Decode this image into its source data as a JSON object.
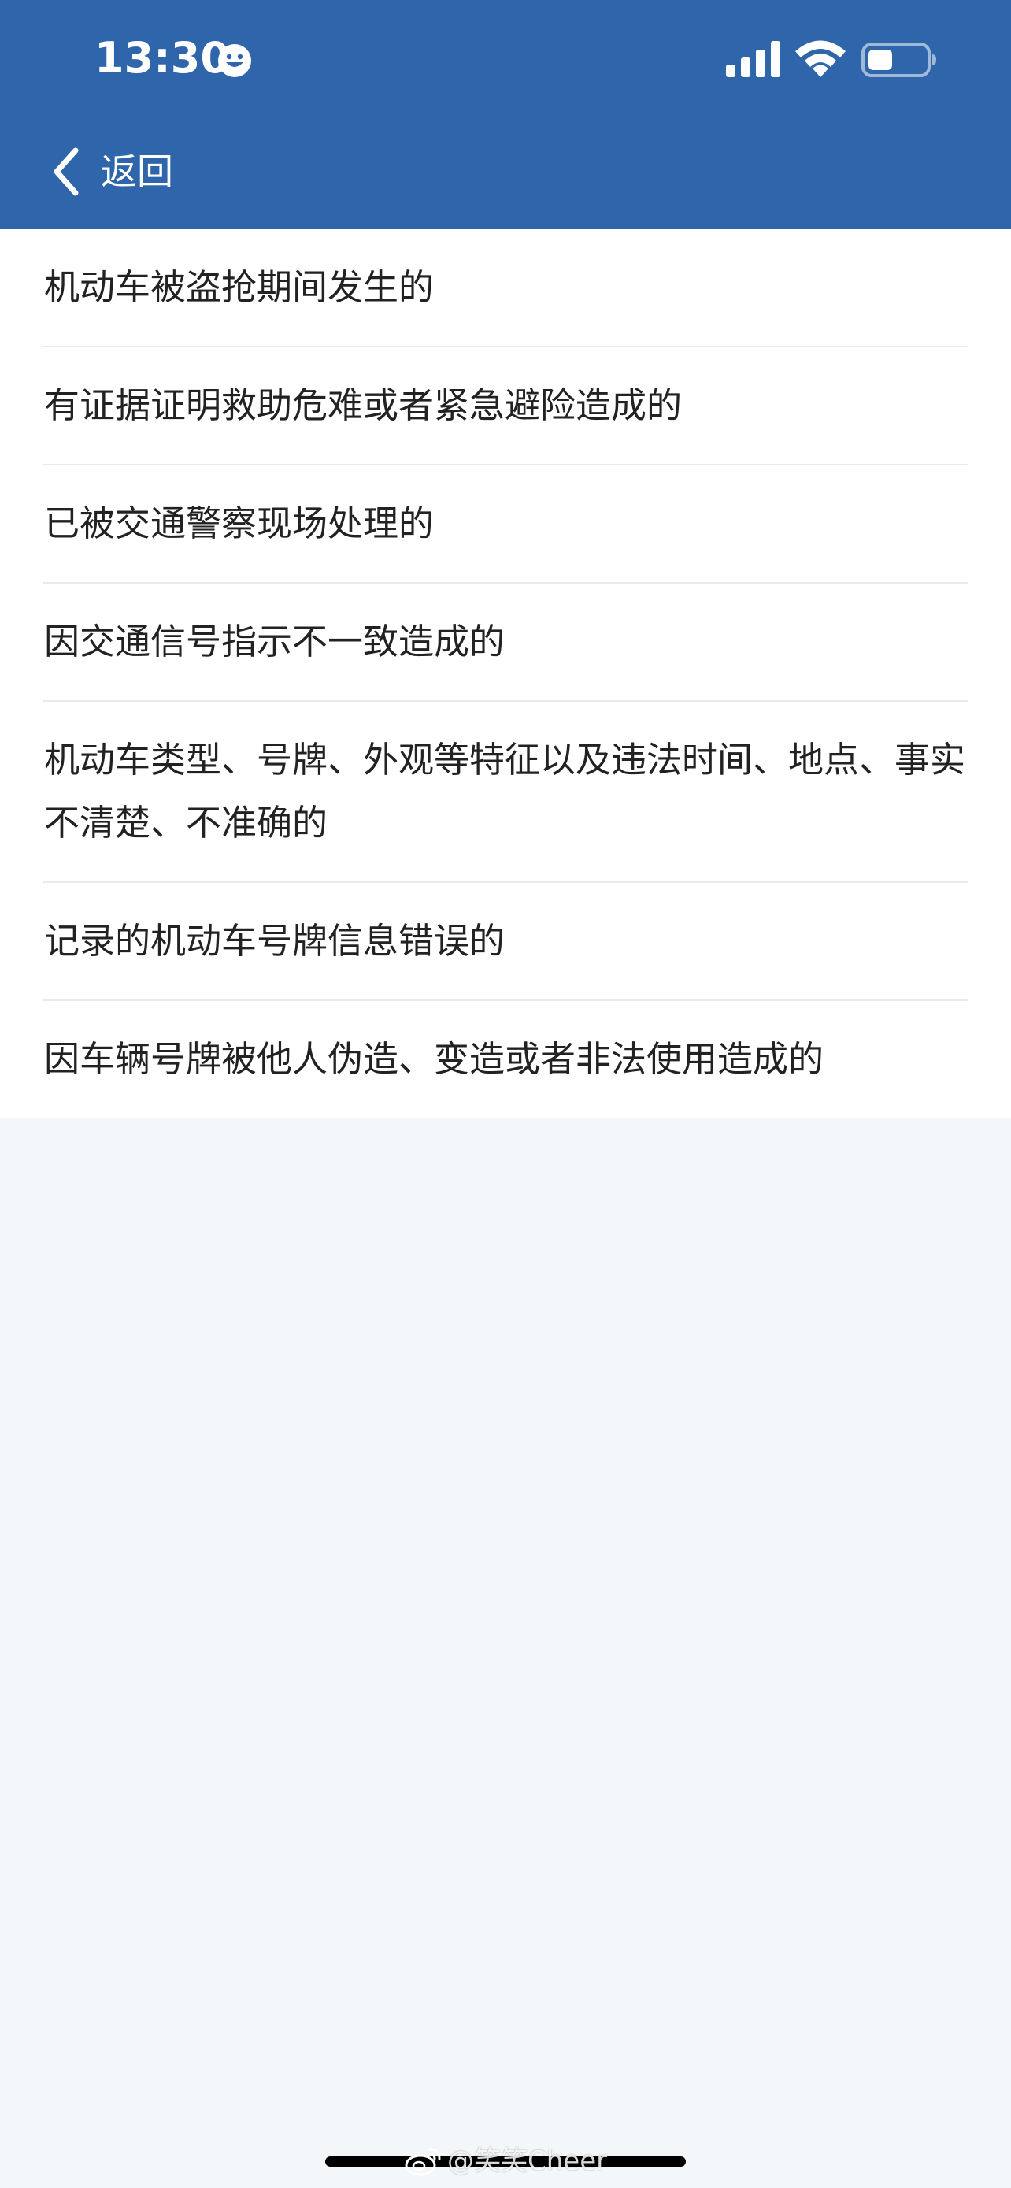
{
  "status_bar": {
    "time": "13:30",
    "icons": [
      "smiley-icon",
      "signal-icon",
      "wifi-icon",
      "battery-icon"
    ]
  },
  "nav": {
    "back_label": "返回",
    "back_icon": "chevron-left-icon"
  },
  "list": {
    "items": [
      "机动车被盗抢期间发生的",
      "有证据证明救助危难或者紧急避险造成的",
      "已被交通警察现场处理的",
      "因交通信号指示不一致造成的",
      "机动车类型、号牌、外观等特征以及违法时间、地点、事实不清楚、不准确的",
      "记录的机动车号牌信息错误的",
      "因车辆号牌被他人伪造、变造或者非法使用造成的"
    ]
  },
  "watermark": {
    "text": "@笑笑Cheer",
    "icon": "weibo-icon"
  },
  "colors": {
    "header_bg": "#2f65aa",
    "page_bg": "#f4f7f9",
    "list_bg": "#ffffff",
    "text": "#222222",
    "divider": "#e8eaed"
  }
}
